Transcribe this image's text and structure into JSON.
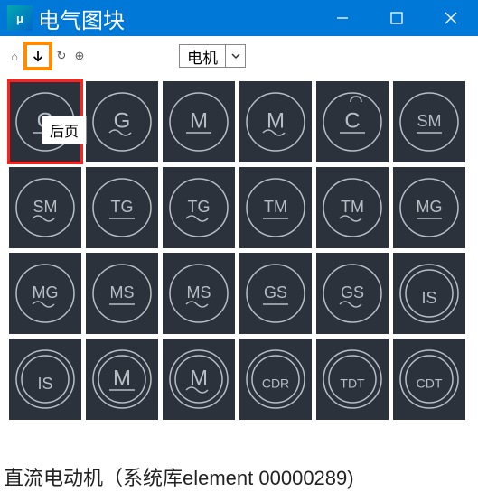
{
  "window": {
    "title": "电气图块",
    "app_icon_text": "μ"
  },
  "toolbar": {
    "tooltip": "后页",
    "dropdown_value": "电机"
  },
  "tiles": [
    {
      "label": "G",
      "underline": true,
      "double_ring": false,
      "wave": false,
      "selected": true
    },
    {
      "label": "G",
      "underline": false,
      "double_ring": false,
      "wave": true,
      "selected": false
    },
    {
      "label": "M",
      "underline": true,
      "double_ring": false,
      "wave": false,
      "selected": false
    },
    {
      "label": "M",
      "underline": false,
      "double_ring": false,
      "wave": true,
      "selected": false
    },
    {
      "label": "C",
      "underline": true,
      "double_ring": false,
      "wave": false,
      "top_hook": true,
      "selected": false
    },
    {
      "label": "SM",
      "underline": true,
      "double_ring": false,
      "wave": false,
      "selected": false
    },
    {
      "label": "SM",
      "underline": false,
      "double_ring": false,
      "wave": true,
      "selected": false
    },
    {
      "label": "TG",
      "underline": true,
      "double_ring": false,
      "wave": false,
      "selected": false
    },
    {
      "label": "TG",
      "underline": false,
      "double_ring": false,
      "wave": true,
      "selected": false
    },
    {
      "label": "TM",
      "underline": true,
      "double_ring": false,
      "wave": false,
      "selected": false
    },
    {
      "label": "TM",
      "underline": false,
      "double_ring": false,
      "wave": true,
      "selected": false
    },
    {
      "label": "MG",
      "underline": true,
      "double_ring": false,
      "wave": false,
      "selected": false
    },
    {
      "label": "MG",
      "underline": false,
      "double_ring": false,
      "wave": true,
      "selected": false
    },
    {
      "label": "MS",
      "underline": true,
      "double_ring": false,
      "wave": false,
      "selected": false
    },
    {
      "label": "MS",
      "underline": false,
      "double_ring": false,
      "wave": true,
      "selected": false
    },
    {
      "label": "GS",
      "underline": true,
      "double_ring": false,
      "wave": false,
      "selected": false
    },
    {
      "label": "GS",
      "underline": false,
      "double_ring": false,
      "wave": true,
      "selected": false
    },
    {
      "label": "IS",
      "underline": false,
      "double_ring": true,
      "wave": false,
      "selected": false
    },
    {
      "label": "IS",
      "underline": false,
      "double_ring": true,
      "wave": false,
      "selected": false
    },
    {
      "label": "M",
      "underline": true,
      "double_ring": true,
      "wave": false,
      "selected": false
    },
    {
      "label": "M",
      "underline": false,
      "double_ring": true,
      "wave": true,
      "selected": false
    },
    {
      "label": "CDR",
      "underline": false,
      "double_ring": true,
      "wave": false,
      "selected": false
    },
    {
      "label": "TDT",
      "underline": false,
      "double_ring": true,
      "wave": false,
      "selected": false
    },
    {
      "label": "CDT",
      "underline": false,
      "double_ring": true,
      "wave": false,
      "selected": false
    }
  ],
  "status": {
    "text": "直流电动机（系统库element 00000289)"
  }
}
